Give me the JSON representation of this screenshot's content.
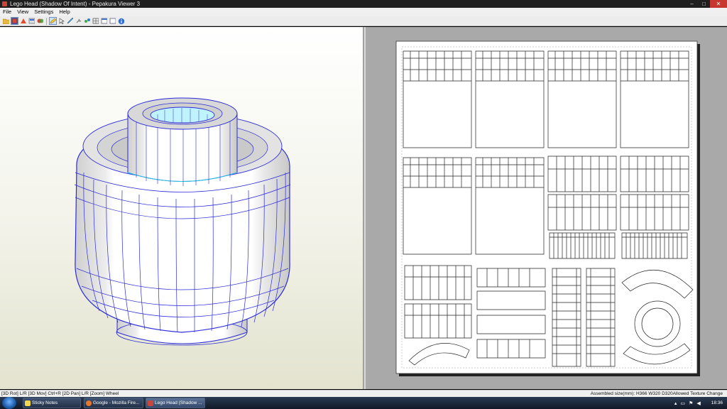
{
  "window": {
    "title": "Lego Head (Shadow Of Intent) - Pepakura Viewer 3"
  },
  "menu": [
    "File",
    "View",
    "Settings",
    "Help"
  ],
  "status": {
    "left": "[3D Rot] L/R [3D Mov] Ctrl+R [2D Pan] L/R [Zoom] Wheel",
    "right": "Assembled size(mm): H366 W320 D320Allowed Texture Change"
  },
  "taskbar": {
    "items": [
      {
        "label": "Sticky Notes",
        "icon_color": "#f3d64a"
      },
      {
        "label": "Google - Mozilla Fire...",
        "icon_color": "#e5772b"
      },
      {
        "label": "Lego Head (Shadow ...",
        "icon_color": "#c8463a"
      }
    ],
    "clock": "18:36"
  },
  "colors": {
    "model_edge": "#2b2bd9",
    "model_face": "#ffffff",
    "model_shade": "#d8d8d8",
    "inner_cyan": "#bff3ff"
  }
}
